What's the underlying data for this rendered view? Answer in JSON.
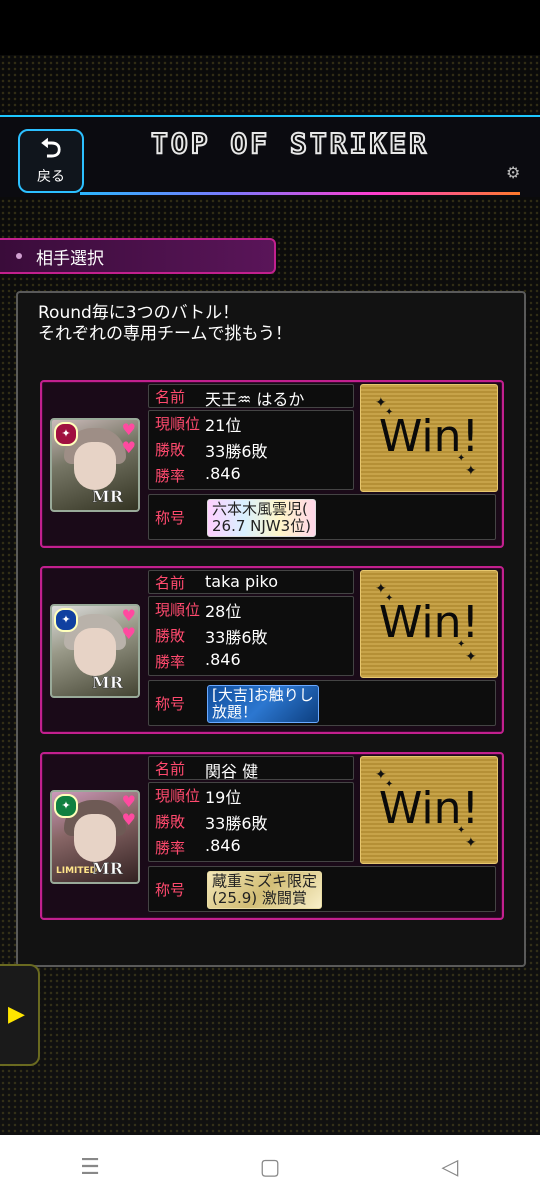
{
  "header": {
    "back_label": "戻る",
    "title": "TOP OF STRIKER"
  },
  "section": {
    "label": "相手選択"
  },
  "intro": {
    "line1": "Round毎に3つのバトル！",
    "line2": "それぞれの専用チームで挑もう！"
  },
  "labels": {
    "name": "名前",
    "rank": "現順位",
    "record": "勝敗",
    "win_rate": "勝率",
    "title": "称号"
  },
  "opponents": [
    {
      "name": "天王♒ はるか",
      "rank": "21位",
      "record": "33勝6敗",
      "win_rate": ".846",
      "result": "Win!",
      "rarity": "MR",
      "title_line1": "六本木風雲児(",
      "title_line2": "26.7 NJW3位)"
    },
    {
      "name": "taka piko",
      "rank": "28位",
      "record": "33勝6敗",
      "win_rate": ".846",
      "result": "Win!",
      "rarity": "MR",
      "title_line1": "[大吉]お触りし",
      "title_line2": "放題！"
    },
    {
      "name": "関谷 健",
      "rank": "19位",
      "record": "33勝6敗",
      "win_rate": ".846",
      "result": "Win!",
      "rarity": "MR",
      "limited": "LIMITED",
      "title_line1": "蔵重ミズキ限定",
      "title_line2": "(25.9) 激闘賞"
    }
  ],
  "colors": {
    "accent_pink": "#c2208e",
    "label_red": "#ff4a6e",
    "header_blue": "#1ec8ff",
    "win_gold": "#c7a349"
  }
}
